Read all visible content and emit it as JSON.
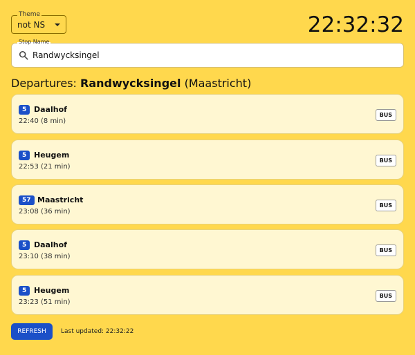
{
  "header": {
    "theme": {
      "label": "Theme",
      "value": "not NS"
    },
    "clock": "22:32:32"
  },
  "search": {
    "label": "Stop Name",
    "value": "Randwycksingel"
  },
  "departures": {
    "title_prefix": "Departures: ",
    "stop": "Randwycksingel",
    "city": "(Maastricht)",
    "items": [
      {
        "route": "5",
        "destination": "Daalhof",
        "time": "22:40 (8 min)",
        "mode": "BUS"
      },
      {
        "route": "5",
        "destination": "Heugem",
        "time": "22:53 (21 min)",
        "mode": "BUS"
      },
      {
        "route": "57",
        "destination": "Maastricht",
        "time": "23:08 (36 min)",
        "mode": "BUS"
      },
      {
        "route": "5",
        "destination": "Daalhof",
        "time": "23:10 (38 min)",
        "mode": "BUS"
      },
      {
        "route": "5",
        "destination": "Heugem",
        "time": "23:23 (51 min)",
        "mode": "BUS"
      }
    ]
  },
  "footer": {
    "refresh_label": "REFRESH",
    "last_updated": "Last updated: 22:32:22"
  },
  "colors": {
    "background": "#FFD84D",
    "card": "#FFF7D2",
    "accent": "#1B50C8"
  },
  "icons": {
    "search": "search-icon",
    "dropdown": "chevron-down-icon"
  }
}
